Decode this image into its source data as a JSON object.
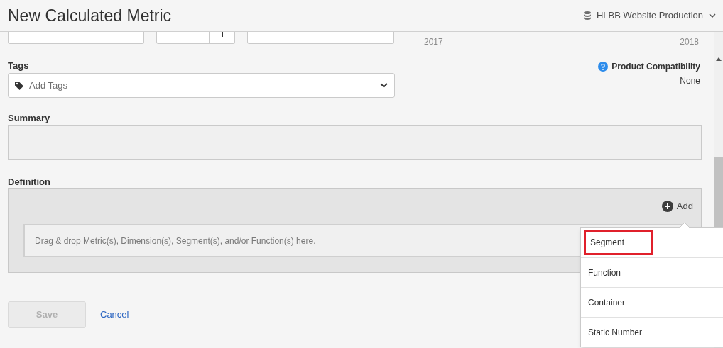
{
  "header": {
    "title": "New Calculated Metric",
    "report_suite": "HLBB Website Production"
  },
  "top_row": {
    "start_year": "2017",
    "end_year": "2018"
  },
  "tags": {
    "label": "Tags",
    "placeholder": "Add Tags"
  },
  "product_compatibility": {
    "label": "Product Compatibility",
    "value": "None"
  },
  "summary": {
    "label": "Summary"
  },
  "definition": {
    "label": "Definition",
    "add_label": "Add",
    "drop_hint": "Drag & drop Metric(s), Dimension(s), Segment(s), and/or Function(s) here."
  },
  "add_menu": [
    {
      "label": "Segment",
      "highlighted": true
    },
    {
      "label": "Function",
      "highlighted": false
    },
    {
      "label": "Container",
      "highlighted": false
    },
    {
      "label": "Static Number",
      "highlighted": false
    }
  ],
  "buttons": {
    "save": {
      "label": "Save",
      "disabled": true
    },
    "cancel": "Cancel"
  }
}
